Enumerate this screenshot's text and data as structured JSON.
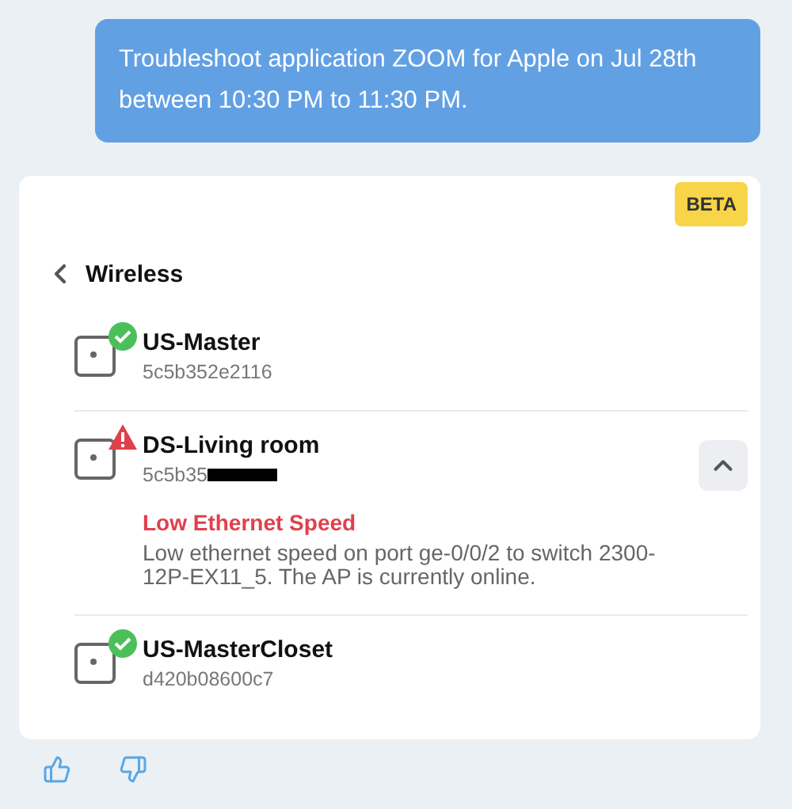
{
  "message": {
    "text": "Troubleshoot application ZOOM for Apple on Jul 28th between 10:30 PM to 11:30 PM."
  },
  "card": {
    "badge": "BETA",
    "back_label": "Wireless",
    "devices": [
      {
        "name": "US-Master",
        "id": "5c5b352e2116",
        "kind": "ok"
      },
      {
        "name": "DS-Living room",
        "id": "5c5b35",
        "redacted": true,
        "kind": "warning",
        "expanded": true,
        "issue": {
          "title": "Low Ethernet Speed",
          "description": "Low ethernet speed on port ge-0/0/2 to switch 2300-12P-EX11_5. The AP is currently online."
        }
      },
      {
        "name": "US-MasterCloset",
        "id": "d420b08600c7",
        "kind": "ok"
      }
    ]
  },
  "feedback": [
    {
      "kind": "like"
    },
    {
      "kind": "dislike"
    }
  ]
}
